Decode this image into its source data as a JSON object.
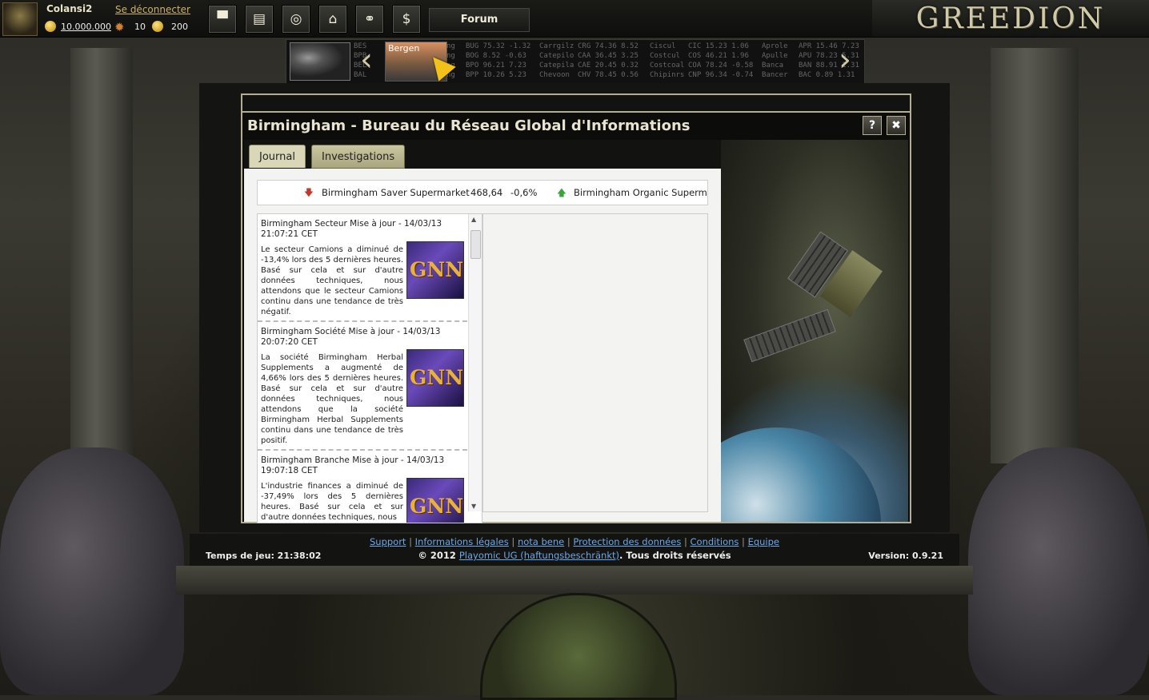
{
  "header": {
    "username": "Colansi2",
    "logout_label": "Se déconnecter",
    "money": "10.000.000",
    "stars": "10",
    "coins": "200",
    "forum_label": "Forum",
    "nav_icons": [
      "chat-icon",
      "notebook-icon",
      "target-icon",
      "factory-icon",
      "handshake-icon",
      "dollar-icon"
    ],
    "logo_text": "GREEDION"
  },
  "ticker_strip": {
    "city_label": "Bergen",
    "columns": [
      "BES\nBPB\nBEL\nBAL",
      "ng\nng\nng\nng",
      "BUG 75.32 -1.32\nBOG 8.52 -0.63\nBPO 96.21 7.23\nBPP 10.26 5.23",
      "Carrgilz\nCatepilo\nCatepila\nChevoon",
      "CRG 74.36 8.52\nCAA 36.45 3.25\nCAE 20.45 0.32\nCHV 78.45 0.56",
      "Ciscul\nCostcul\nCostcoal\nChipinrs",
      "CIC 15.23 1.06\nCOS 46.21 1.96\nCOA 78.24 -0.58\nCNP 96.34 -0.74",
      "Aprole\nApulle\nBanca\nBancer",
      "APR 15.46 7.23\nAPU 78.23 5.31\nBAN 88.91 1.31\nBAC 0.89 1.31"
    ]
  },
  "window": {
    "title": "Birmingham - Bureau du Réseau Global d'Informations",
    "help_label": "?",
    "close_label": "✖",
    "tabs": [
      "Journal",
      "Investigations"
    ],
    "ticker": [
      {
        "dir": "down",
        "arrow": "🡇",
        "name": "Birmingham Saver Supermarket",
        "value": "468,64",
        "change": "-0,6%"
      },
      {
        "dir": "up",
        "arrow": "🡅",
        "name": "Birmingham Organic Supermar",
        "value": "",
        "change": ""
      }
    ],
    "news": [
      {
        "title": "Birmingham Secteur Mise à jour - 14/03/13 21:07:21 CET",
        "body": "Le secteur Camions a diminué de -13,4% lors des 5 dernières heures. Basé sur cela et sur d'autre données techniques, nous attendons que le secteur Camions continu dans une tendance de très négatif.",
        "logo": "GNN"
      },
      {
        "title": "Birmingham Société Mise à jour - 14/03/13 20:07:20 CET",
        "body": "La société Birmingham Herbal Supplements a augmenté de 4,66% lors des 5 dernières heures. Basé sur cela et sur d'autre données techniques, nous attendons que la société Birmingham Herbal Supplements continu dans une tendance de très positif.",
        "logo": "GNN"
      },
      {
        "title": "Birmingham Branche Mise à jour - 14/03/13 19:07:18 CET",
        "body": "L'industrie finances a diminué de -37,49% lors des 5 dernières heures. Basé sur cela et sur d'autre données techniques, nous",
        "logo": "GNN"
      }
    ]
  },
  "footer": {
    "links": [
      "Support",
      "Informations légales",
      "nota bene",
      "Protection des données",
      "Conditions",
      "Equipe"
    ],
    "game_time": "Temps de jeu: 21:38:02",
    "copyright_prefix": "© 2012",
    "company": "Playomic UG (haftungsbeschränkt)",
    "copyright_suffix": ". Tous droits réservés",
    "version": "Version: 0.9.21"
  }
}
